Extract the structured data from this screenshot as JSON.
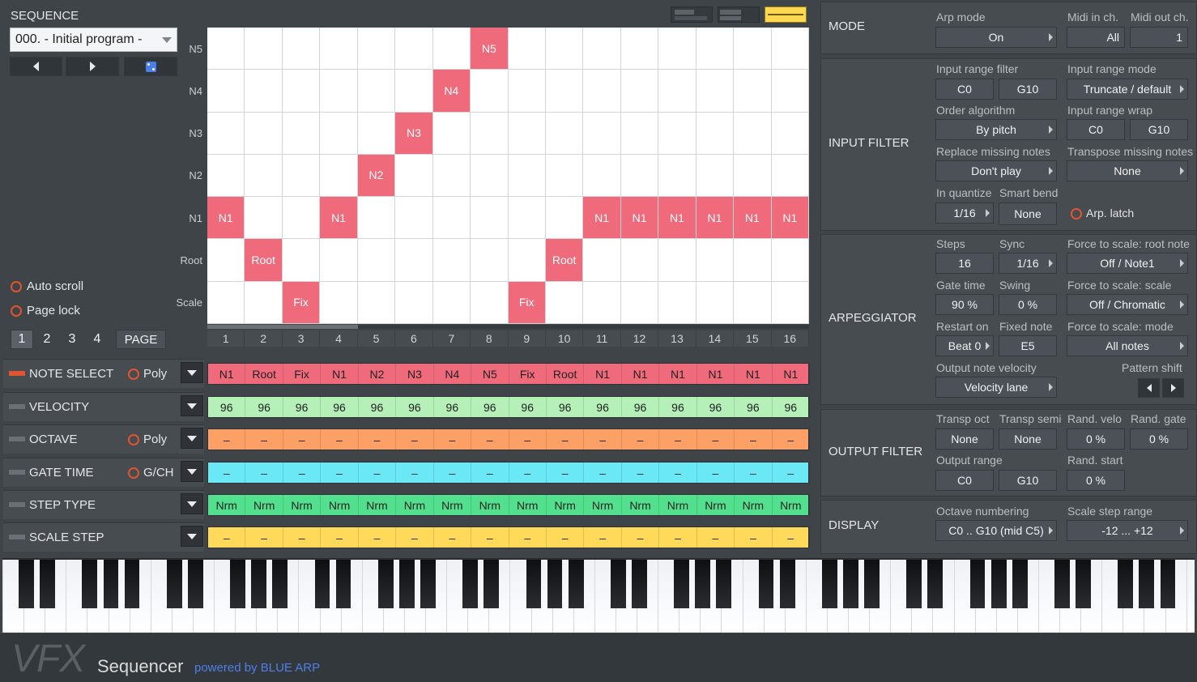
{
  "app": {
    "brand": "VFX",
    "name": "Sequencer",
    "powered_by": "powered by BLUE ARP",
    "accent": "#e0552f",
    "note_color": "#ef6a7b"
  },
  "sequence": {
    "title": "SEQUENCE",
    "program": "000. - Initial program -",
    "prev_icon": "triangle-left",
    "next_icon": "triangle-right",
    "random_icon": "dice",
    "auto_scroll": "Auto scroll",
    "page_lock": "Page lock",
    "pages": [
      "1",
      "2",
      "3",
      "4"
    ],
    "active_page": "1",
    "page_label": "PAGE"
  },
  "grid": {
    "row_labels": [
      "N5",
      "N4",
      "N3",
      "N2",
      "N1",
      "Root",
      "Scale"
    ],
    "step_numbers": [
      "1",
      "2",
      "3",
      "4",
      "5",
      "6",
      "7",
      "8",
      "9",
      "10",
      "11",
      "12",
      "13",
      "14",
      "15",
      "16"
    ],
    "active": [
      {
        "step": 1,
        "row": "N1",
        "label": "N1"
      },
      {
        "step": 2,
        "row": "Root",
        "label": "Root"
      },
      {
        "step": 3,
        "row": "Scale",
        "label": "Fix"
      },
      {
        "step": 4,
        "row": "N1",
        "label": "N1"
      },
      {
        "step": 5,
        "row": "N2",
        "label": "N2"
      },
      {
        "step": 6,
        "row": "N3",
        "label": "N3"
      },
      {
        "step": 7,
        "row": "N4",
        "label": "N4"
      },
      {
        "step": 8,
        "row": "N5",
        "label": "N5"
      },
      {
        "step": 9,
        "row": "Scale",
        "label": "Fix"
      },
      {
        "step": 10,
        "row": "Root",
        "label": "Root"
      },
      {
        "step": 11,
        "row": "N1",
        "label": "N1"
      },
      {
        "step": 12,
        "row": "N1",
        "label": "N1"
      },
      {
        "step": 13,
        "row": "N1",
        "label": "N1"
      },
      {
        "step": 14,
        "row": "N1",
        "label": "N1"
      },
      {
        "step": 15,
        "row": "N1",
        "label": "N1"
      },
      {
        "step": 16,
        "row": "N1",
        "label": "N1"
      }
    ]
  },
  "lanes": [
    {
      "name": "NOTE SELECT",
      "option": "Poly",
      "active": true,
      "color": "#ef6a7b",
      "text_color": "#222222",
      "values": [
        "N1",
        "Root",
        "Fix",
        "N1",
        "N2",
        "N3",
        "N4",
        "N5",
        "Fix",
        "Root",
        "N1",
        "N1",
        "N1",
        "N1",
        "N1",
        "N1"
      ]
    },
    {
      "name": "VELOCITY",
      "option": "",
      "active": false,
      "color": "#b4f0b8",
      "text_color": "#222222",
      "values": [
        "96",
        "96",
        "96",
        "96",
        "96",
        "96",
        "96",
        "96",
        "96",
        "96",
        "96",
        "96",
        "96",
        "96",
        "96",
        "96"
      ]
    },
    {
      "name": "OCTAVE",
      "option": "Poly",
      "active": false,
      "color": "#fda066",
      "text_color": "#222222",
      "values": [
        "–",
        "–",
        "–",
        "–",
        "–",
        "–",
        "–",
        "–",
        "–",
        "–",
        "–",
        "–",
        "–",
        "–",
        "–",
        "–"
      ]
    },
    {
      "name": "GATE TIME",
      "option": "G/CH",
      "active": false,
      "color": "#6ae8f5",
      "text_color": "#222222",
      "values": [
        "–",
        "–",
        "–",
        "–",
        "–",
        "–",
        "–",
        "–",
        "–",
        "–",
        "–",
        "–",
        "–",
        "–",
        "–",
        "–"
      ]
    },
    {
      "name": "STEP TYPE",
      "option": "",
      "active": false,
      "color": "#52e08e",
      "text_color": "#222222",
      "values": [
        "Nrm",
        "Nrm",
        "Nrm",
        "Nrm",
        "Nrm",
        "Nrm",
        "Nrm",
        "Nrm",
        "Nrm",
        "Nrm",
        "Nrm",
        "Nrm",
        "Nrm",
        "Nrm",
        "Nrm",
        "Nrm"
      ]
    },
    {
      "name": "SCALE STEP",
      "option": "",
      "active": false,
      "color": "#ffd95a",
      "text_color": "#222222",
      "values": [
        "–",
        "–",
        "–",
        "–",
        "–",
        "–",
        "–",
        "–",
        "–",
        "–",
        "–",
        "–",
        "–",
        "–",
        "–",
        "–"
      ]
    }
  ],
  "mode": {
    "title": "MODE",
    "arp_mode_label": "Arp mode",
    "arp_mode": "On",
    "midi_in_label": "Midi in ch.",
    "midi_in": "All",
    "midi_out_label": "Midi out ch.",
    "midi_out": "1"
  },
  "input_filter": {
    "title": "INPUT FILTER",
    "range_filter_label": "Input range filter",
    "range_low": "C0",
    "range_high": "G10",
    "range_mode_label": "Input range mode",
    "range_mode": "Truncate / default",
    "order_label": "Order algorithm",
    "order": "By pitch",
    "wrap_label": "Input range wrap",
    "wrap_low": "C0",
    "wrap_high": "G10",
    "replace_label": "Replace missing notes",
    "replace": "Don't play",
    "transpose_label": "Transpose missing notes",
    "transpose": "None",
    "quantize_label": "In quantize",
    "quantize": "1/16",
    "smart_bend_label": "Smart bend",
    "smart_bend": "None",
    "latch_label": "Arp. latch"
  },
  "arpeggiator": {
    "title": "ARPEGGIATOR",
    "steps_label": "Steps",
    "steps": "16",
    "sync_label": "Sync",
    "sync": "1/16",
    "fts_root_label": "Force to scale: root note",
    "fts_root": "Off / Note1",
    "gate_label": "Gate time",
    "gate": "90 %",
    "swing_label": "Swing",
    "swing": "0 %",
    "fts_scale_label": "Force to scale: scale",
    "fts_scale": "Off / Chromatic",
    "restart_label": "Restart on",
    "restart": "Beat 0",
    "fixed_label": "Fixed note",
    "fixed": "E5",
    "fts_mode_label": "Force to scale: mode",
    "fts_mode": "All notes",
    "velocity_label": "Output note velocity",
    "velocity": "Velocity lane",
    "pattern_shift_label": "Pattern shift"
  },
  "output_filter": {
    "title": "OUTPUT FILTER",
    "transp_oct_label": "Transp oct",
    "transp_oct": "None",
    "transp_semi_label": "Transp semi",
    "transp_semi": "None",
    "rand_velo_label": "Rand. velo",
    "rand_velo": "0 %",
    "rand_gate_label": "Rand. gate",
    "rand_gate": "0 %",
    "range_label": "Output range",
    "range_low": "C0",
    "range_high": "G10",
    "rand_start_label": "Rand. start",
    "rand_start": "0 %"
  },
  "display": {
    "title": "DISPLAY",
    "octave_label": "Octave numbering",
    "octave": "C0 .. G10 (mid C5)",
    "scale_range_label": "Scale step range",
    "scale_range": "-12 ... +12"
  }
}
